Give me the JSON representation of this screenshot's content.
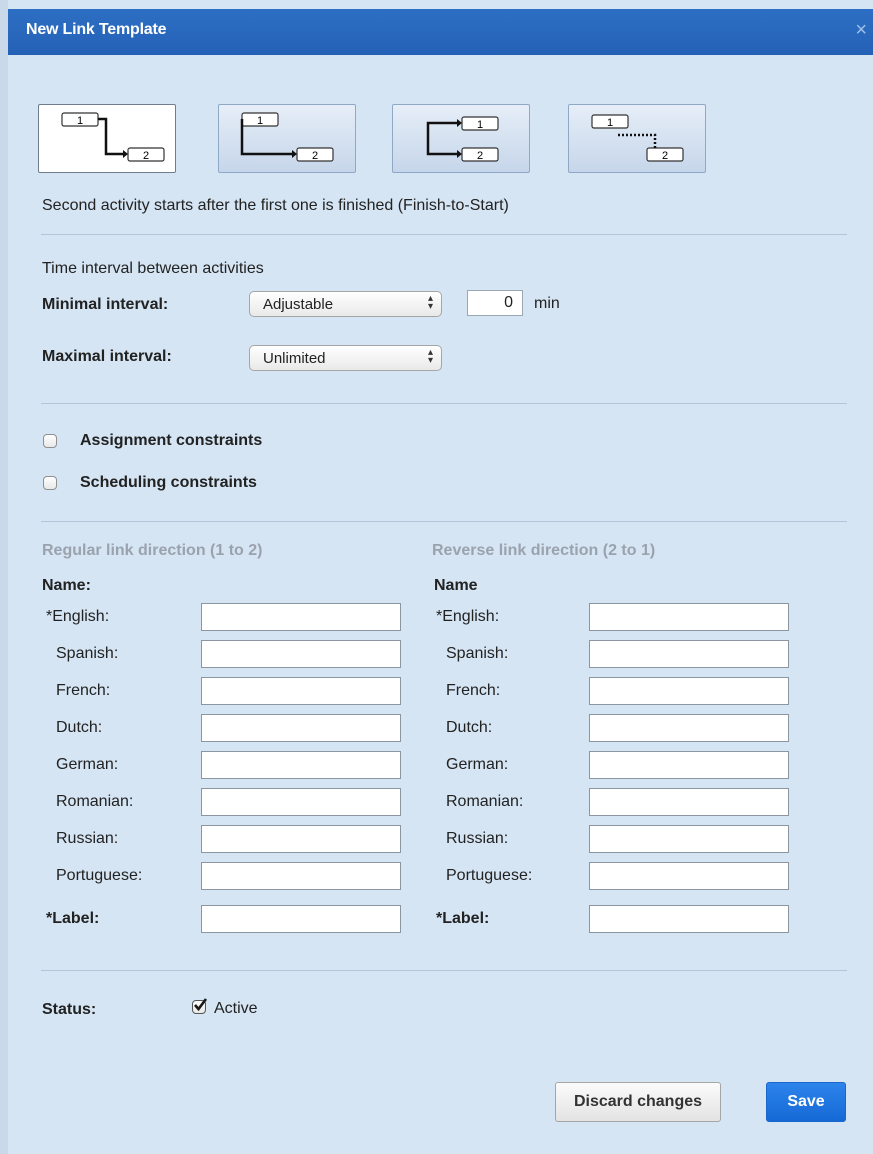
{
  "dialog": {
    "title": "New Link Template",
    "close_glyph": "×"
  },
  "link_types": [
    {
      "name": "finish-to-start",
      "box1": "1",
      "box2": "2",
      "selected": true
    },
    {
      "name": "start-to-start",
      "box1": "1",
      "box2": "2",
      "selected": false
    },
    {
      "name": "finish-to-finish",
      "box1": "1",
      "box2": "2",
      "selected": false
    },
    {
      "name": "custom-dotted",
      "box1": "1",
      "box2": "2",
      "selected": false
    }
  ],
  "description": "Second activity starts after the first one is finished (Finish-to-Start)",
  "interval": {
    "heading": "Time interval between activities",
    "minimal_label": "Minimal interval:",
    "minimal_value": "Adjustable",
    "minimal_amount": "0",
    "minimal_unit": "min",
    "maximal_label": "Maximal interval:",
    "maximal_value": "Unlimited"
  },
  "constraints": {
    "assignment_label": "Assignment constraints",
    "scheduling_label": "Scheduling constraints"
  },
  "regular": {
    "heading": "Regular link direction (1 to 2)",
    "name_label": "Name:",
    "languages": [
      "*English:",
      "Spanish:",
      "French:",
      "Dutch:",
      "German:",
      "Romanian:",
      "Russian:",
      "Portuguese:"
    ],
    "label_label": "*Label:"
  },
  "reverse": {
    "heading": "Reverse link direction (2 to 1)",
    "name_label": "Name",
    "languages": [
      "*English:",
      "Spanish:",
      "French:",
      "Dutch:",
      "German:",
      "Romanian:",
      "Russian:",
      "Portuguese:"
    ],
    "label_label": "*Label:"
  },
  "status": {
    "label": "Status:",
    "active_label": "Active",
    "active_checked": true
  },
  "buttons": {
    "discard": "Discard changes",
    "save": "Save"
  },
  "colors": {
    "titlebar": "#2566bd",
    "background": "#d5e5f4",
    "save_button": "#1b6cd9"
  }
}
